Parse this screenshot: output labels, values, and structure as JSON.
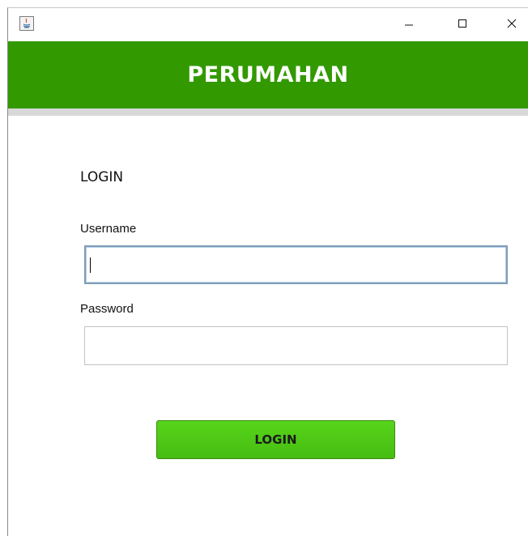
{
  "window": {
    "app_icon": "java-icon",
    "controls": {
      "minimize_icon": "minimize-icon",
      "maximize_icon": "maximize-icon",
      "close_icon": "close-icon"
    }
  },
  "header": {
    "title": "PERUMAHAN",
    "background": "#339900"
  },
  "form": {
    "heading": "LOGIN",
    "username": {
      "label": "Username",
      "value": ""
    },
    "password": {
      "label": "Password",
      "value": ""
    },
    "submit_label": "LOGIN",
    "button_color": "#4ec816"
  }
}
